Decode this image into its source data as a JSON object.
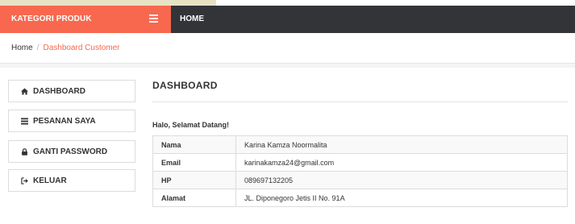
{
  "navbar": {
    "brand": "KATEGORI PRODUK",
    "home": "HOME"
  },
  "breadcrumb": {
    "home": "Home",
    "separator": "/",
    "current": "Dashboard Customer"
  },
  "sidebar": {
    "items": [
      {
        "label": "DASHBOARD",
        "icon": "home-icon"
      },
      {
        "label": "PESANAN SAYA",
        "icon": "list-icon"
      },
      {
        "label": "GANTI PASSWORD",
        "icon": "lock-icon"
      },
      {
        "label": "KELUAR",
        "icon": "sign-out-icon"
      }
    ]
  },
  "main": {
    "title": "DASHBOARD",
    "greeting": "Halo, Selamat Datang!",
    "rows": [
      {
        "key": "Nama",
        "value": "Karina Kamza Noormalita"
      },
      {
        "key": "Email",
        "value": "karinakamza24@gmail.com"
      },
      {
        "key": "HP",
        "value": "089697132205"
      },
      {
        "key": "Alamat",
        "value": "JL. Diponegoro Jetis II No. 91A"
      }
    ]
  },
  "colors": {
    "accent": "#f7684e",
    "navbar": "#333438",
    "border": "#dcdcdc"
  }
}
